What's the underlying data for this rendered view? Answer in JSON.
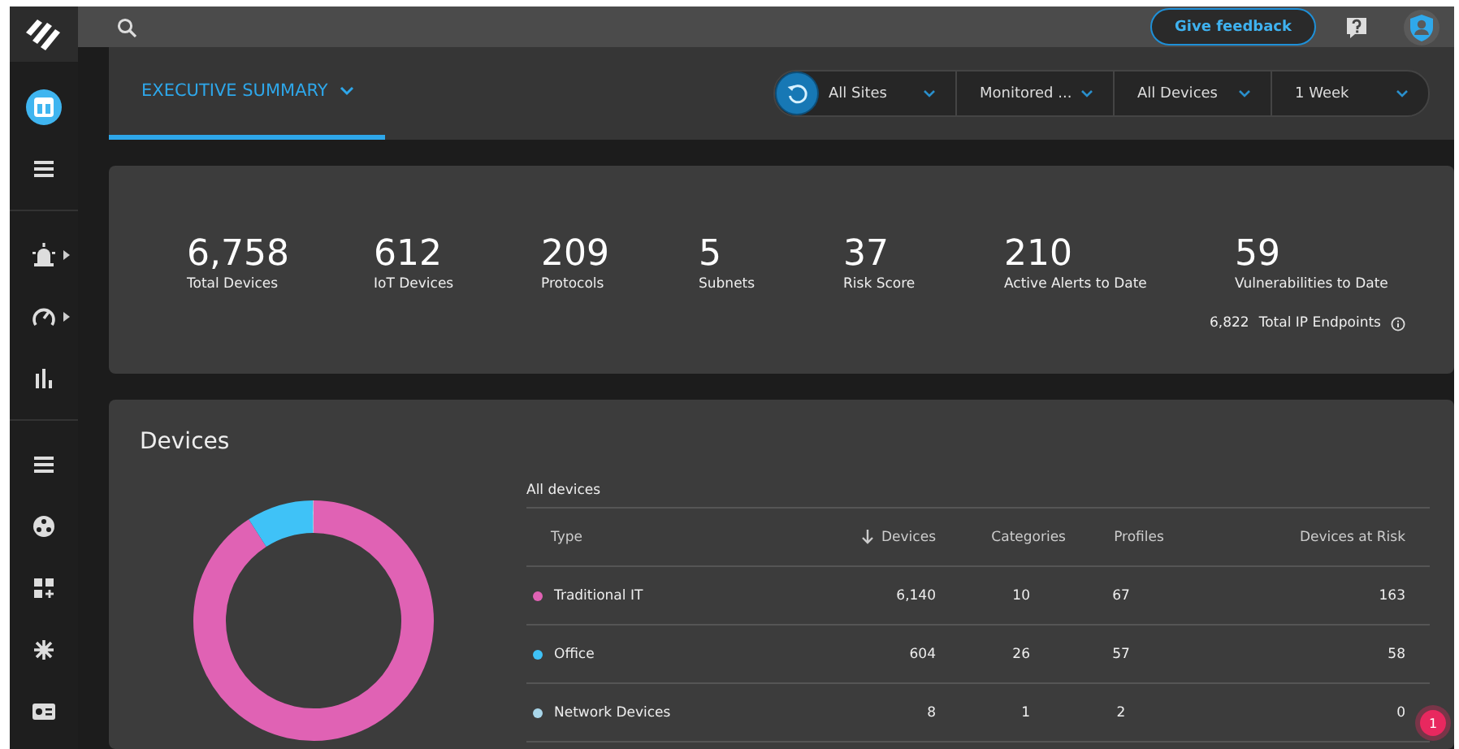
{
  "topbar": {
    "feedback_button": "Give feedback"
  },
  "sidebar": {
    "items": [
      {
        "kind": "layout",
        "selected": true,
        "submenu": false
      },
      {
        "kind": "list",
        "selected": false,
        "submenu": false
      },
      {
        "kind": "alarm",
        "selected": false,
        "submenu": true,
        "group_start": true
      },
      {
        "kind": "gauge",
        "selected": false,
        "submenu": true
      },
      {
        "kind": "bars",
        "selected": false,
        "submenu": false
      },
      {
        "kind": "list",
        "selected": false,
        "submenu": false,
        "group_start": true
      },
      {
        "kind": "dots",
        "selected": false,
        "submenu": false
      },
      {
        "kind": "grid",
        "selected": false,
        "submenu": false
      },
      {
        "kind": "network",
        "selected": false,
        "submenu": false
      },
      {
        "kind": "card",
        "selected": false,
        "submenu": false
      }
    ]
  },
  "tab": {
    "label": "EXECUTIVE SUMMARY",
    "selected": true
  },
  "filters": [
    {
      "label": "All Sites"
    },
    {
      "label": "Monitored ..."
    },
    {
      "label": "All Devices"
    },
    {
      "label": "1 Week"
    }
  ],
  "stats": [
    {
      "value": "6,758",
      "label": "Total Devices"
    },
    {
      "value": "612",
      "label": "IoT Devices"
    },
    {
      "value": "209",
      "label": "Protocols"
    },
    {
      "value": "5",
      "label": "Subnets"
    },
    {
      "value": "37",
      "label": "Risk Score"
    },
    {
      "value": "210",
      "label": "Active Alerts to Date"
    },
    {
      "value": "59",
      "label": "Vulnerabilities to Date"
    }
  ],
  "endpoints": {
    "value": "6,822",
    "label": "Total IP Endpoints"
  },
  "devices": {
    "title": "Devices",
    "table_title": "All devices",
    "columns": [
      "Type",
      "Devices",
      "Categories",
      "Profiles",
      "Devices at Risk"
    ],
    "rows": [
      {
        "type": "Traditional IT",
        "color": "#e062b4",
        "devices": "6,140",
        "categories": "10",
        "profiles": "67",
        "at_risk": "163"
      },
      {
        "type": "Office",
        "color": "#3fc2f7",
        "devices": "604",
        "categories": "26",
        "profiles": "57",
        "at_risk": "58"
      },
      {
        "type": "Network Devices",
        "color": "#a9d6ea",
        "devices": "8",
        "categories": "1",
        "profiles": "2",
        "at_risk": "0"
      }
    ]
  },
  "notification_badge": "1"
}
